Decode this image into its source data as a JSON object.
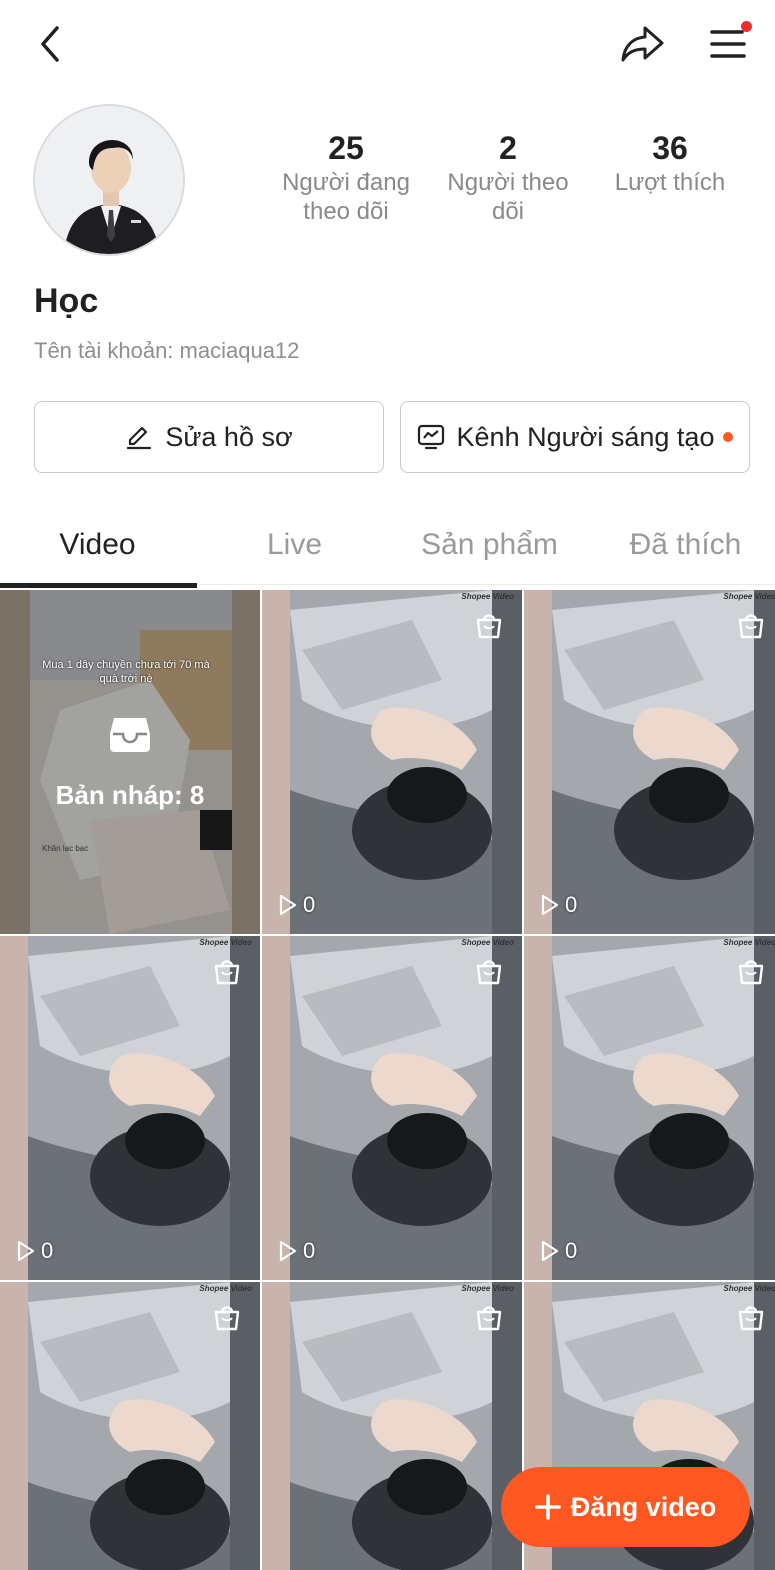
{
  "header": {
    "back_icon": "chevron-left-icon",
    "share_icon": "share-icon",
    "menu_icon": "hamburger-menu-icon",
    "notification_dot_color": "#ee2c2c"
  },
  "profile": {
    "name": "Học",
    "username": "Tên tài khoản: maciaqua12",
    "stats": [
      {
        "value": "25",
        "label_line1": "Người đang",
        "label_line2": "theo dõi"
      },
      {
        "value": "2",
        "label_line1": "Người theo",
        "label_line2": "dõi"
      },
      {
        "value": "36",
        "label_line1": "Lượt thích",
        "label_line2": ""
      }
    ]
  },
  "actions": {
    "edit_profile": "Sửa hồ sơ",
    "creator_channel": "Kênh Người sáng tạo"
  },
  "tabs": [
    {
      "label": "Video",
      "active": true
    },
    {
      "label": "Live",
      "active": false
    },
    {
      "label": "Sản phẩm",
      "active": false
    },
    {
      "label": "Đã thích",
      "active": false
    }
  ],
  "grid": {
    "draft": {
      "label": "Bản nháp: 8",
      "caption": "Mua 1 dây chuyền chưa tới 70 mà quà trời nè",
      "caption2": "Khăn lạc bạc"
    },
    "brand_mark": "Shopee Video",
    "videos": [
      {
        "views": "0"
      },
      {
        "views": "0"
      },
      {
        "views": "0"
      },
      {
        "views": "0"
      },
      {
        "views": "0"
      },
      {
        "views": ""
      },
      {
        "views": ""
      },
      {
        "views": ""
      }
    ]
  },
  "fab": {
    "label": "Đăng video",
    "color": "#fe5722"
  }
}
